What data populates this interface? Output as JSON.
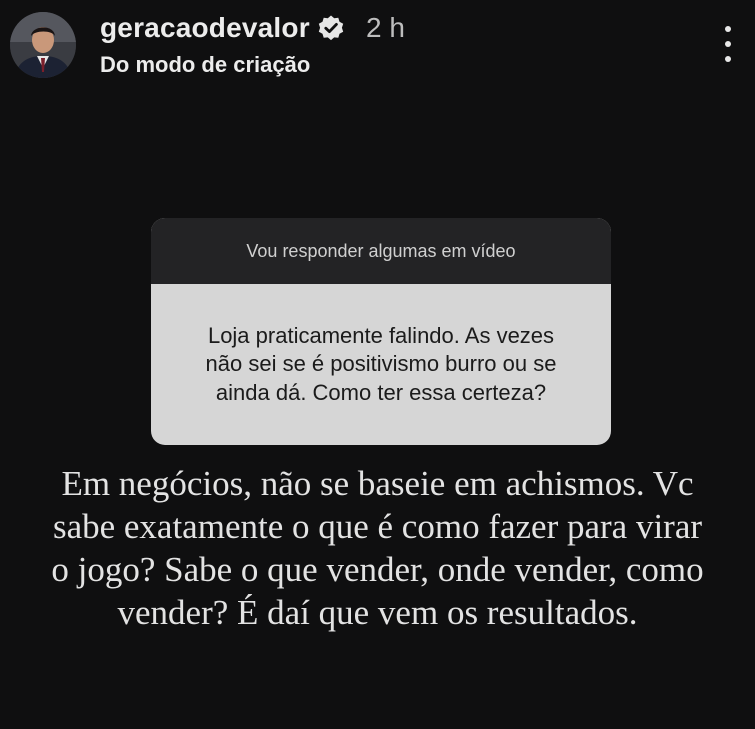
{
  "header": {
    "username": "geracaodevalor",
    "verified_icon": "verified-badge-icon",
    "time": "2 h",
    "subtitle": "Do modo de criação",
    "more_icon": "more-vertical-icon"
  },
  "question_sticker": {
    "title": "Vou responder algumas em vídeo",
    "question": "Loja praticamente falindo. As vezes\nnão sei se é positivismo burro ou se\nainda dá. Como ter essa certeza?"
  },
  "answer_text": "Em negócios, não se baseie em achismos. Vc\nsabe exatamente o que é como fazer para virar\no jogo? Sabe o que vender, onde vender, como\nvender? É daí que vem os resultados.",
  "colors": {
    "background": "#0f0f10",
    "sticker_header": "#232325",
    "sticker_body": "#d6d6d6",
    "text": "#e3e3e3"
  }
}
